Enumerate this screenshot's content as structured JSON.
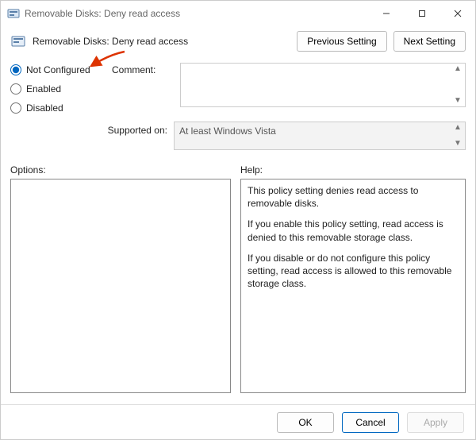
{
  "window": {
    "title": "Removable Disks: Deny read access"
  },
  "header": {
    "title": "Removable Disks: Deny read access",
    "prev_button": "Previous Setting",
    "next_button": "Next Setting"
  },
  "radios": {
    "not_configured": "Not Configured",
    "enabled": "Enabled",
    "disabled": "Disabled",
    "selected": "not_configured"
  },
  "comment": {
    "label": "Comment:",
    "value": ""
  },
  "supported": {
    "label": "Supported on:",
    "value": "At least Windows Vista"
  },
  "lower": {
    "options_label": "Options:",
    "help_label": "Help:"
  },
  "help": {
    "p1": "This policy setting denies read access to removable disks.",
    "p2": "If you enable this policy setting, read access is denied to this removable storage class.",
    "p3": "If you disable or do not configure this policy setting, read access is allowed to this removable storage class."
  },
  "footer": {
    "ok": "OK",
    "cancel": "Cancel",
    "apply": "Apply"
  }
}
